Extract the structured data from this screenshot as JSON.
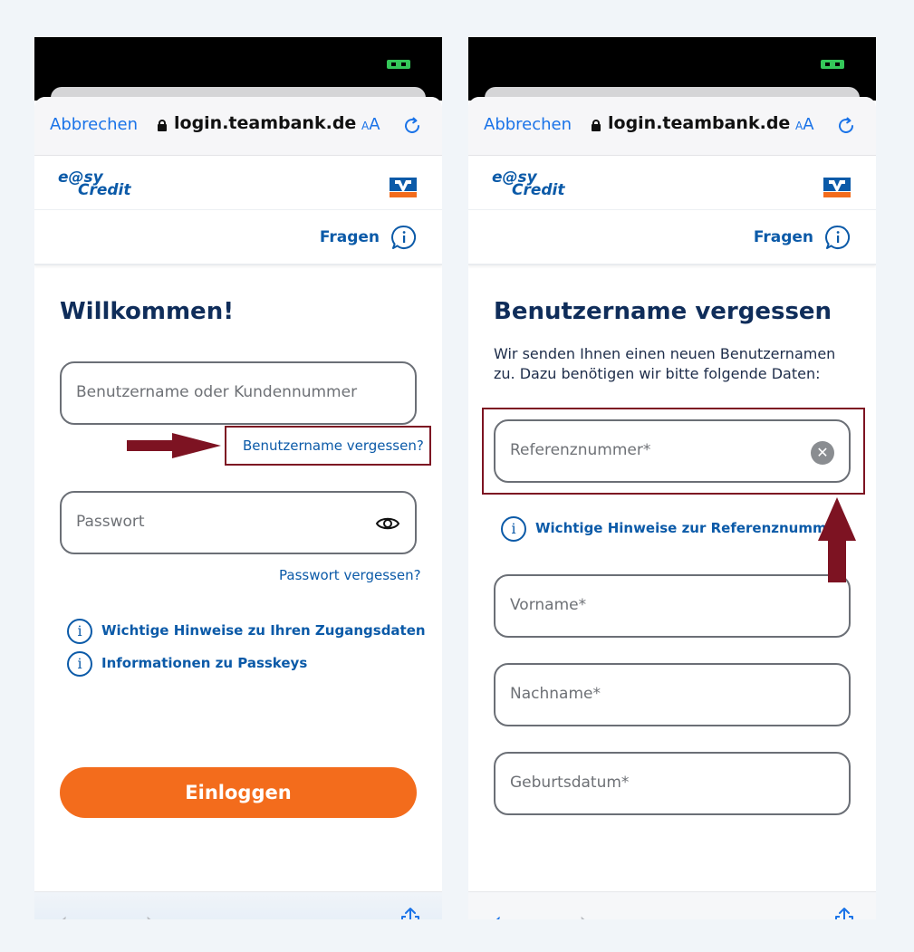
{
  "browser": {
    "cancel_label": "Abbrechen",
    "domain": "login.teambank.de",
    "text_size_label_small": "A",
    "text_size_label_large": "A"
  },
  "site": {
    "logo_line1": "e@sy",
    "logo_line2": "Credit",
    "fragen_label": "Fragen"
  },
  "login": {
    "title": "Willkommen!",
    "username_placeholder": "Benutzername oder Kundennummer",
    "forgot_username_link": "Benutzername vergessen?",
    "password_placeholder": "Passwort",
    "forgot_password_link": "Passwort vergessen?",
    "info_links": [
      "Wichtige Hinweise zu Ihren Zugangsdaten",
      "Informationen zu Passkeys"
    ],
    "login_button": "Einloggen"
  },
  "forgot": {
    "title": "Benutzername vergessen",
    "lead": "Wir senden Ihnen einen neuen Benutzernamen zu. Dazu benötigen wir bitte folgende Daten:",
    "reference_placeholder": "Referenznummer*",
    "reference_info_link": "Wichtige Hinweise zur Referenznummer",
    "firstname_placeholder": "Vorname*",
    "lastname_placeholder": "Nachname*",
    "birthdate_placeholder": "Geburtsdatum*"
  },
  "icons": {
    "info_glyph": "i",
    "clear_glyph": "✕",
    "back_glyph": "‹",
    "forward_glyph": "›"
  },
  "colors": {
    "brand_blue": "#0b5aa8",
    "heading_navy": "#0f2d5a",
    "accent_orange": "#f36c1c",
    "ios_blue": "#1a73e8",
    "annotation_red": "#7d1322"
  }
}
